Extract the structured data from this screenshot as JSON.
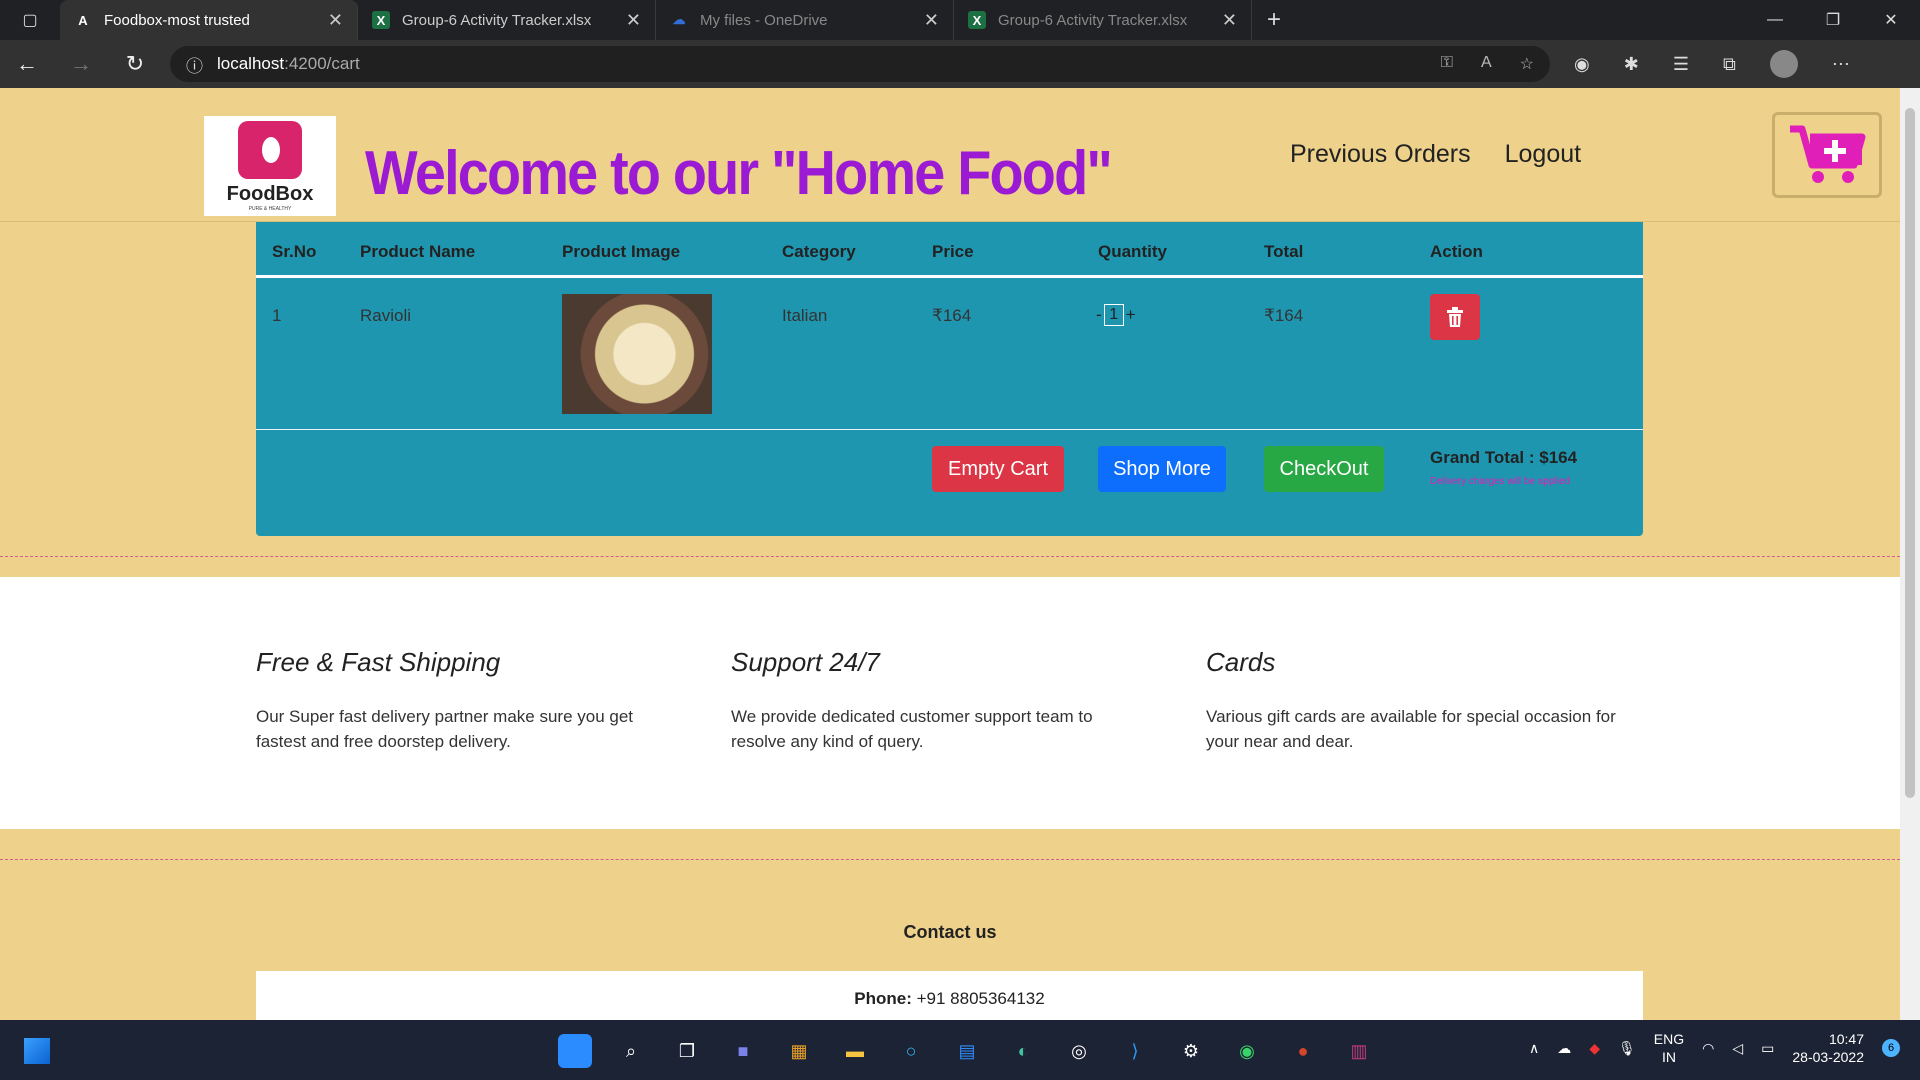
{
  "browser": {
    "tabs": [
      {
        "title": "Foodbox-most trusted",
        "icon": "angular-icon",
        "active": true
      },
      {
        "title": "Group-6 Activity Tracker.xlsx",
        "icon": "excel-icon",
        "active": false
      },
      {
        "title": "My files - OneDrive",
        "icon": "onedrive-icon",
        "active": false
      },
      {
        "title": "Group-6 Activity Tracker.xlsx",
        "icon": "excel-icon",
        "active": false
      }
    ],
    "address_host": "localhost",
    "address_path": ":4200/cart"
  },
  "header": {
    "logo_text": "FoodBox",
    "logo_sub": "PURE & HEALTHY",
    "welcome": "Welcome to our \"Home Food\"",
    "nav": [
      "Previous Orders",
      "Logout"
    ]
  },
  "cart": {
    "columns": [
      "Sr.No",
      "Product Name",
      "Product Image",
      "Category",
      "Price",
      "Quantity",
      "Total",
      "Action"
    ],
    "rows": [
      {
        "srno": "1",
        "name": "Ravioli",
        "category": "Italian",
        "price": "₹164",
        "quantity": "1",
        "total": "₹164"
      }
    ],
    "qty_minus": "-",
    "qty_plus": "+",
    "empty_cart": "Empty Cart",
    "shop_more": "Shop More",
    "checkout": "CheckOut",
    "grand_total": "Grand Total : $164",
    "delivery_note": "Delivery charges will be applied"
  },
  "features": [
    {
      "title": "Free & Fast Shipping",
      "text": "Our Super fast delivery partner make sure you get fastest and free doorstep delivery."
    },
    {
      "title": "Support 24/7",
      "text": "We provide dedicated customer support team to resolve any kind of query."
    },
    {
      "title": "Cards",
      "text": "Various gift cards are available for special occasion for your near and dear."
    }
  ],
  "contact": {
    "title": "Contact us",
    "phone_label": "Phone:",
    "phone_value": " +91 8805364132"
  },
  "taskbar": {
    "lang_top": "ENG",
    "lang_bottom": "IN",
    "time": "10:47",
    "date": "28-03-2022",
    "notification_count": "6"
  },
  "colors": {
    "page_bg": "#eed28b",
    "table_bg": "#1f96b0",
    "welcome": "#9a1bd3",
    "cart_icon": "#e01fb8"
  }
}
